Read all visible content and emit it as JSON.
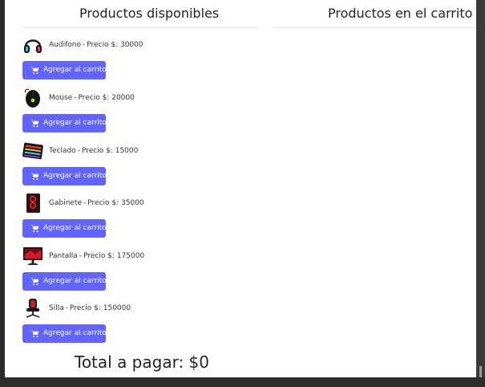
{
  "available": {
    "title": "Productos disponibles",
    "price_prefix": "Precio $:",
    "add_label": "Agregar al carrito",
    "items": [
      {
        "name": "Audifono",
        "price": "30000",
        "icon": "headphones-icon"
      },
      {
        "name": "Mouse",
        "price": "20000",
        "icon": "mouse-icon"
      },
      {
        "name": "Teclado",
        "price": "15000",
        "icon": "keyboard-icon"
      },
      {
        "name": "Gabinete",
        "price": "35000",
        "icon": "pc-case-icon"
      },
      {
        "name": "Pantalla",
        "price": "175000",
        "icon": "monitor-icon"
      },
      {
        "name": "Silla",
        "price": "150000",
        "icon": "gaming-chair-icon"
      }
    ]
  },
  "cart": {
    "title": "Productos en el carrito",
    "items": []
  },
  "total": {
    "label": "Total a pagar: $0"
  },
  "colors": {
    "button": "#6164ff",
    "button_text": "#ffffff"
  }
}
